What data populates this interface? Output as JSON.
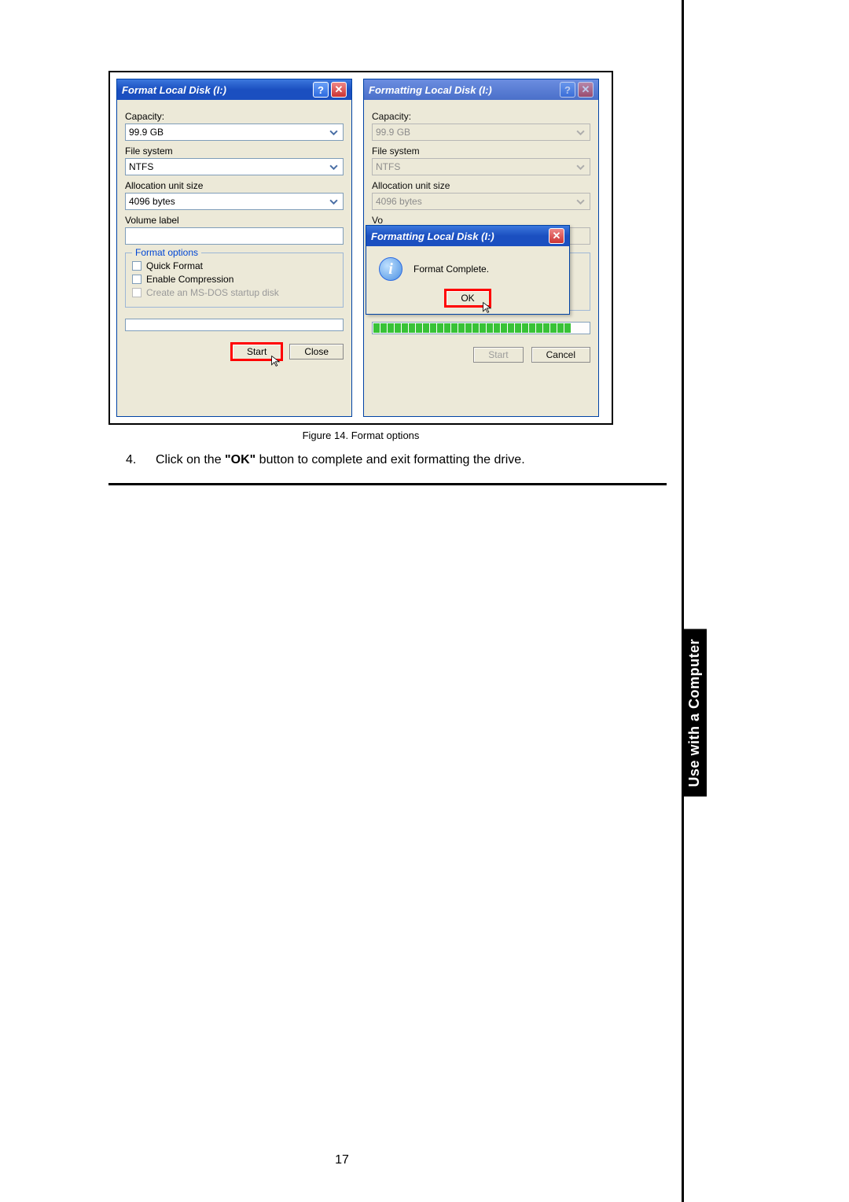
{
  "left_dialog": {
    "title": "Format Local Disk (I:)",
    "labels": {
      "capacity": "Capacity:",
      "filesystem": "File system",
      "alloc": "Allocation unit size",
      "volume": "Volume label",
      "fieldset": "Format options",
      "quick": "Quick Format",
      "compress": "Enable Compression",
      "msdos": "Create an MS-DOS startup disk"
    },
    "values": {
      "capacity": "99.9 GB",
      "filesystem": "NTFS",
      "alloc": "4096 bytes",
      "volume": ""
    },
    "buttons": {
      "start": "Start",
      "close": "Close"
    }
  },
  "right_dialog": {
    "title": "Formatting Local Disk (I:)",
    "labels": {
      "capacity": "Capacity:",
      "filesystem": "File system",
      "alloc": "Allocation unit size",
      "volume_partial": "Vo"
    },
    "values": {
      "capacity": "99.9 GB",
      "filesystem": "NTFS",
      "alloc": "4096 bytes"
    },
    "buttons": {
      "start": "Start",
      "cancel": "Cancel"
    },
    "popup": {
      "title": "Formatting Local Disk (I:)",
      "message": "Format Complete.",
      "ok": "OK"
    }
  },
  "caption": "Figure 14. Format options",
  "step": {
    "num": "4.",
    "prefix": "Click on the ",
    "bold": "\"OK\"",
    "suffix": " button to complete and exit formatting the drive."
  },
  "side_tab": "Use with a Computer",
  "page_number": "17",
  "icons": {
    "info": "i",
    "help": "?",
    "close": "✕"
  }
}
